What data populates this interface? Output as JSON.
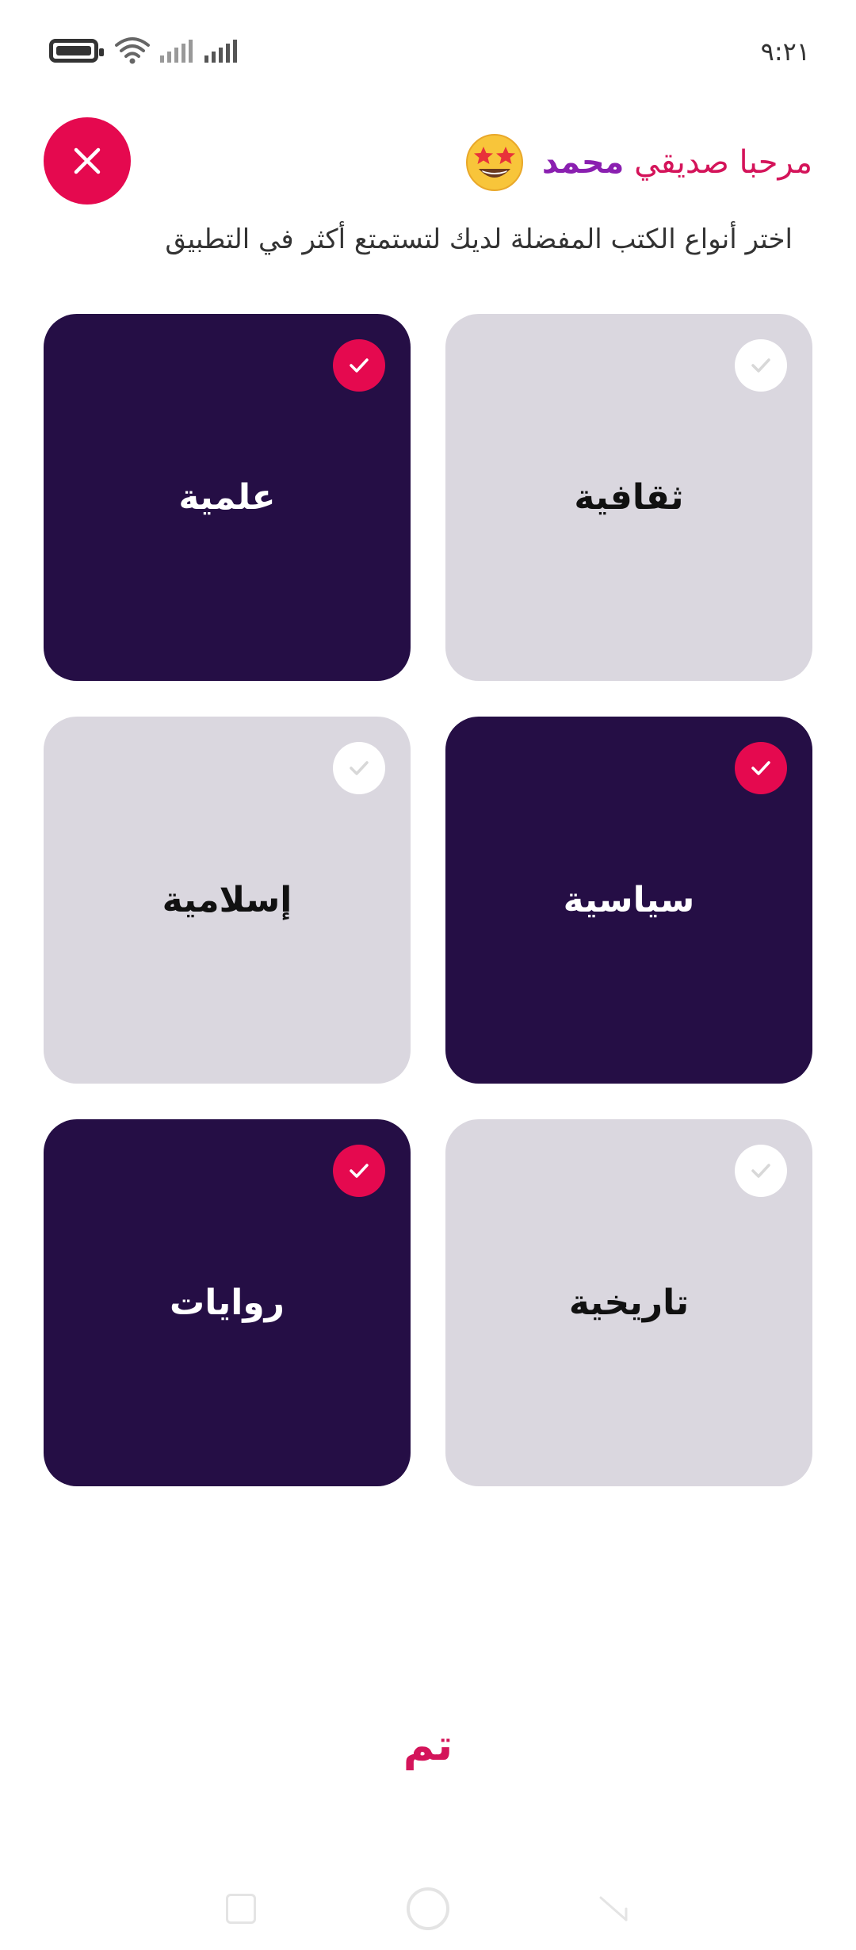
{
  "status_bar": {
    "time": "٩:٢١",
    "icons": [
      "battery-icon",
      "wifi-icon",
      "signal-icon",
      "signal-icon"
    ]
  },
  "header": {
    "greeting_prefix": "مرحبا صديقي",
    "user_name": "محمد",
    "emoji": "star-struck-emoji",
    "subtitle": "اختر أنواع الكتب المفضلة لديك لتستمتع أكثر في التطبيق",
    "close_icon": "close-icon"
  },
  "categories": [
    {
      "label": "ثقافية",
      "selected": false
    },
    {
      "label": "علمية",
      "selected": true
    },
    {
      "label": "سياسية",
      "selected": true
    },
    {
      "label": "إسلامية",
      "selected": false
    },
    {
      "label": "تاريخية",
      "selected": false
    },
    {
      "label": "روايات",
      "selected": true
    }
  ],
  "done_label": "تم",
  "colors": {
    "accent": "#e5094f",
    "greeting": "#d4145a",
    "name": "#8a1fb0",
    "selected_tile": "#250e45",
    "unselected_tile": "#dad7df"
  }
}
